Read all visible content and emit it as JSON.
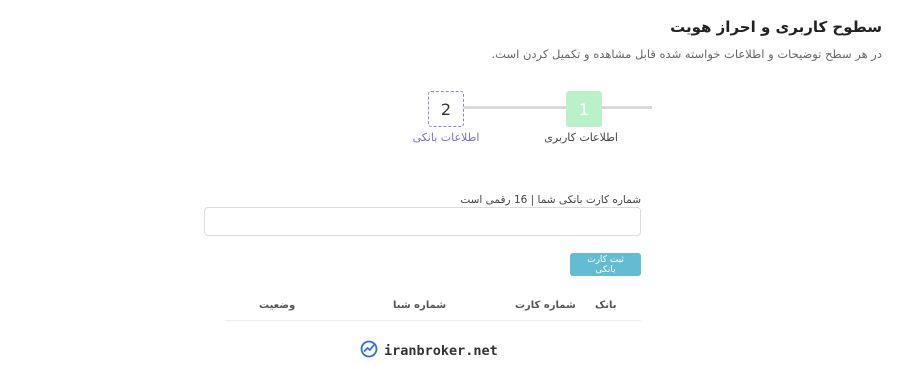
{
  "header": {
    "title": "سطوح کاربری و احراز هویت",
    "subtitle": "در هر سطح توضیحات و اطلاعات خواسته شده قابل مشاهده و تکمیل کردن است."
  },
  "steps": [
    {
      "number": "1",
      "label": "اطلاعات کاربری",
      "state": "completed"
    },
    {
      "number": "2",
      "label": "اطلاعات بانکی",
      "state": "active"
    }
  ],
  "form": {
    "card_label": "شماره کارت بانکی شما | 16 رقمی است",
    "card_value": "",
    "submit_label": "ثبت کارت بانکی"
  },
  "table": {
    "headers": [
      "بانک",
      "شماره کارت",
      "شماره شبا",
      "وضعیت"
    ]
  },
  "watermark": {
    "text": "iranbroker.net",
    "icon": "trend-chart-icon"
  },
  "colors": {
    "step_done": "#b9f1c9",
    "step_active_border": "#8e86c9",
    "button": "#63bcd1"
  }
}
